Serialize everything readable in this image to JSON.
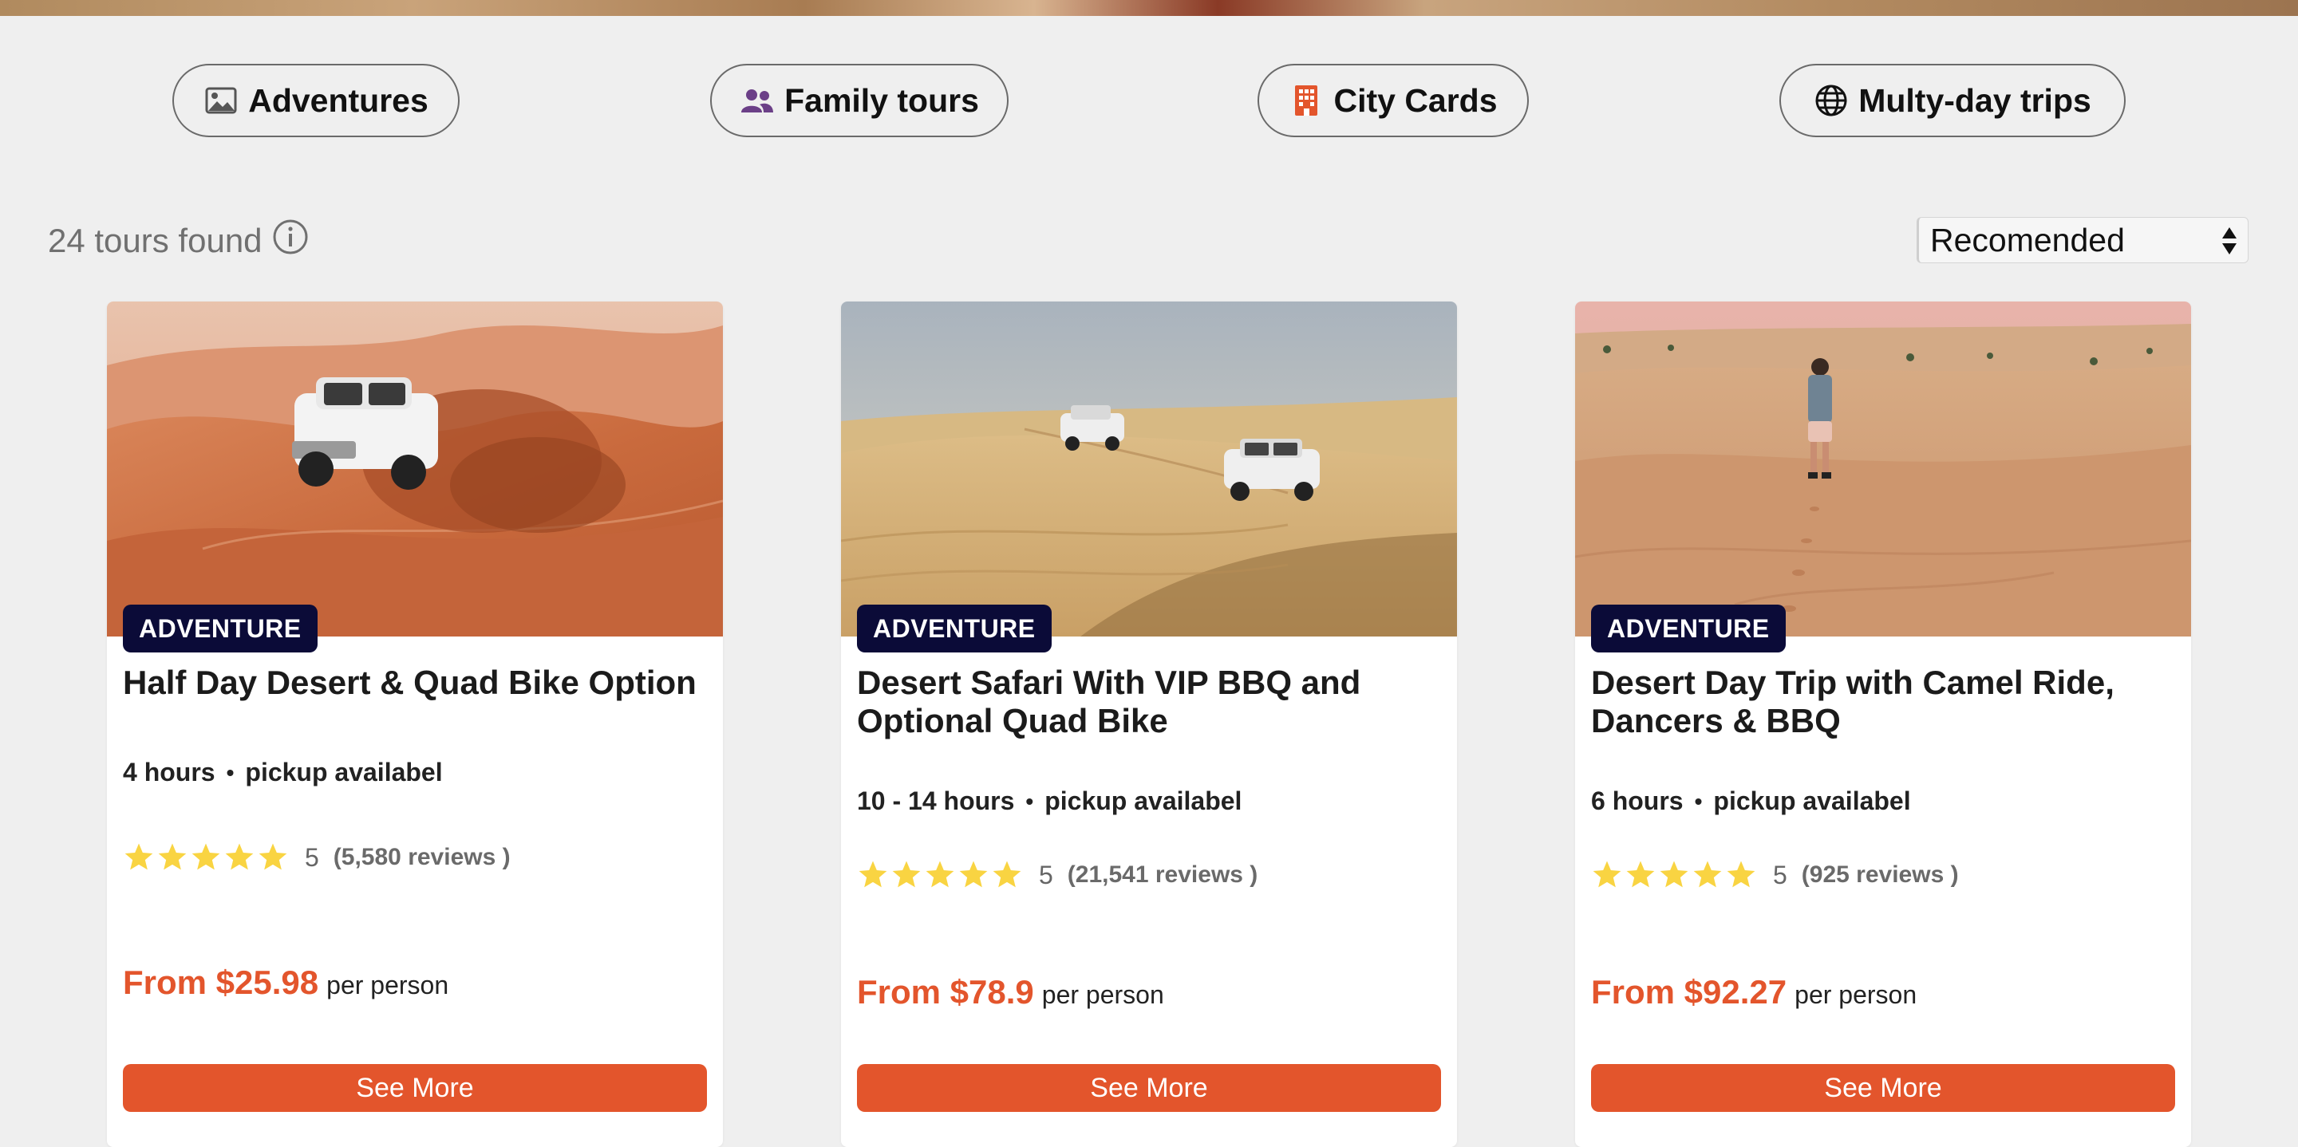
{
  "categories": [
    {
      "label": "Adventures",
      "icon": "image-icon"
    },
    {
      "label": "Family tours",
      "icon": "users-icon"
    },
    {
      "label": "City Cards",
      "icon": "building-icon"
    },
    {
      "label": "Multy-day trips",
      "icon": "globe-icon"
    }
  ],
  "results": {
    "count_text": "24 tours found",
    "info_icon": "info-icon"
  },
  "sort": {
    "selected": "Recomended"
  },
  "colors": {
    "accent": "#e3552c",
    "badge": "#0b0b38",
    "star": "#f9d442",
    "family_icon": "#6b3f87",
    "city_icon": "#e3552c"
  },
  "cards": [
    {
      "badge": "ADVENTURE",
      "title": "Half Day Desert & Quad Bike Option",
      "duration": "4 hours",
      "pickup": "pickup availabel",
      "rating": 5,
      "score": "5",
      "reviews": "(5,580 reviews )",
      "price": "From $25.98",
      "per": "per person",
      "button": "See More",
      "image": "desert-4x4-dust-photo"
    },
    {
      "badge": "ADVENTURE",
      "title": "Desert Safari With VIP BBQ and Optional Quad Bike",
      "duration": "10 - 14 hours",
      "pickup": "pickup availabel",
      "rating": 5,
      "score": "5",
      "reviews": "(21,541 reviews )",
      "price": "From $78.9",
      "per": "per person",
      "button": "See More",
      "image": "desert-two-suvs-photo"
    },
    {
      "badge": "ADVENTURE",
      "title": "Desert Day Trip with Camel Ride, Dancers & BBQ",
      "duration": "6 hours",
      "pickup": "pickup availabel",
      "rating": 5,
      "score": "5",
      "reviews": "(925 reviews )",
      "price": "From $92.27",
      "per": "per person",
      "button": "See More",
      "image": "desert-walker-photo"
    }
  ]
}
